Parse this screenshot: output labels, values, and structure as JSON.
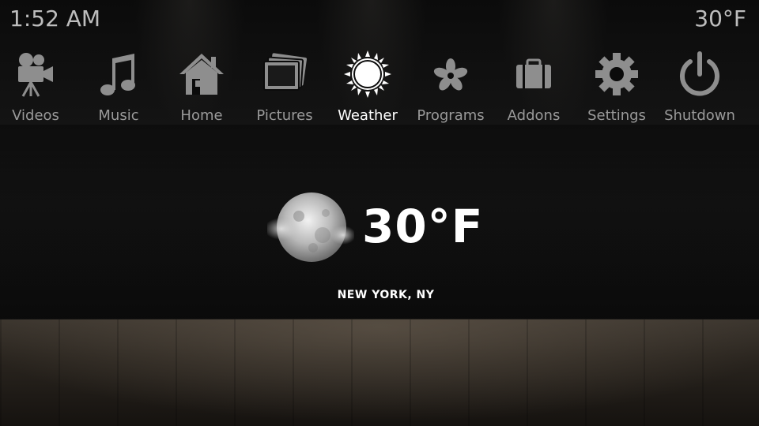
{
  "status": {
    "time": "1:52 AM",
    "temperature": "30°F"
  },
  "menu": {
    "active": "weather",
    "items": [
      {
        "id": "videos",
        "label": "Videos",
        "icon": "film-camera-icon"
      },
      {
        "id": "music",
        "label": "Music",
        "icon": "music-note-icon"
      },
      {
        "id": "home",
        "label": "Home",
        "icon": "house-icon"
      },
      {
        "id": "pictures",
        "label": "Pictures",
        "icon": "photos-icon"
      },
      {
        "id": "weather",
        "label": "Weather",
        "icon": "sun-icon"
      },
      {
        "id": "programs",
        "label": "Programs",
        "icon": "flower-icon"
      },
      {
        "id": "addons",
        "label": "Addons",
        "icon": "briefcase-icon"
      },
      {
        "id": "settings",
        "label": "Settings",
        "icon": "gear-icon"
      },
      {
        "id": "shutdown",
        "label": "Shutdown",
        "icon": "power-icon"
      }
    ]
  },
  "weather": {
    "condition_icon": "cloudy-moon-icon",
    "temperature": "30°F",
    "location": "NEW YORK, NY"
  },
  "colors": {
    "text_inactive": "#9a9a9a",
    "text_active": "#ffffff",
    "icon_color": "#8e8e8e"
  }
}
